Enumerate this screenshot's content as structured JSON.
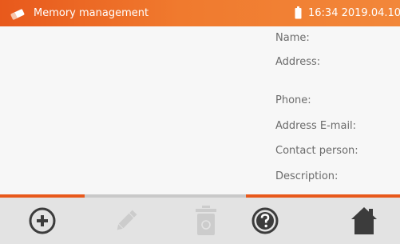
{
  "header": {
    "app_icon": "eraser-icon",
    "title": "Memory management",
    "battery_icon": "battery-icon",
    "time": "16:34",
    "date": "2019.04.10"
  },
  "fields": [
    {
      "label": "Name:"
    },
    {
      "label": "Address:"
    },
    {
      "label": "Phone:"
    },
    {
      "label": "Address E-mail:"
    },
    {
      "label": "Contact person:"
    },
    {
      "label": "Description:"
    }
  ],
  "progress": {
    "segments": [
      {
        "color": "#e8591c"
      },
      {
        "color": "#c9c9c9"
      },
      {
        "color": "#e8591c"
      }
    ]
  },
  "toolbar": {
    "buttons": [
      {
        "icon": "add-circle-icon",
        "enabled": true
      },
      {
        "icon": "pencil-icon",
        "enabled": false
      },
      {
        "icon": "trash-icon",
        "enabled": false
      },
      {
        "icon": "help-icon",
        "enabled": true
      },
      {
        "icon": "home-icon",
        "enabled": true
      }
    ]
  },
  "colors": {
    "accent": "#e8591c",
    "icon_enabled": "#3c3c3c",
    "icon_disabled": "#cccccc"
  }
}
